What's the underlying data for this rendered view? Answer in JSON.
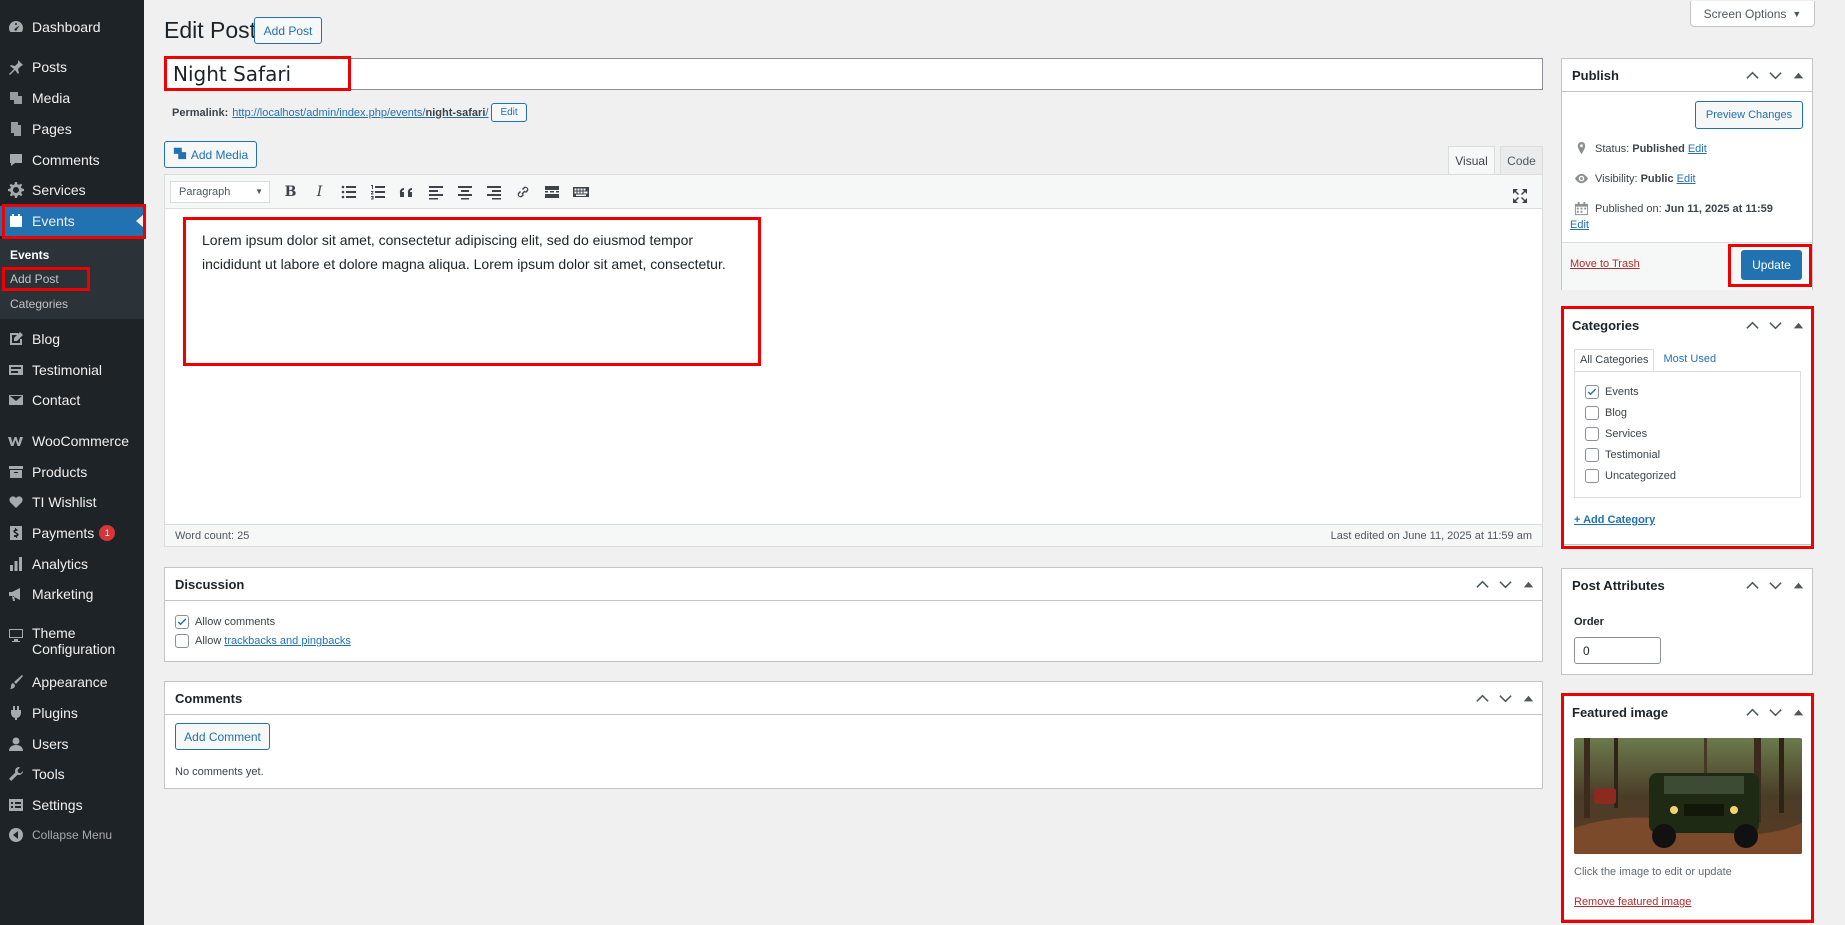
{
  "sidebar": {
    "items": [
      {
        "label": "Dashboard",
        "icon": "dashboard-icon"
      },
      {
        "label": "Posts",
        "icon": "pin-icon"
      },
      {
        "label": "Media",
        "icon": "media-icon"
      },
      {
        "label": "Pages",
        "icon": "pages-icon"
      },
      {
        "label": "Comments",
        "icon": "comments-icon"
      },
      {
        "label": "Services",
        "icon": "gear-icon"
      },
      {
        "label": "Events",
        "icon": "events-icon"
      },
      {
        "label": "Blog",
        "icon": "edit-icon"
      },
      {
        "label": "Testimonial",
        "icon": "testimonial-icon"
      },
      {
        "label": "Contact",
        "icon": "mail-icon"
      },
      {
        "label": "WooCommerce",
        "icon": "woocommerce-icon"
      },
      {
        "label": "Products",
        "icon": "archive-icon"
      },
      {
        "label": "TI Wishlist",
        "icon": "heart-icon"
      },
      {
        "label": "Payments",
        "icon": "dollar-icon",
        "badge": "1"
      },
      {
        "label": "Analytics",
        "icon": "chart-bar-icon"
      },
      {
        "label": "Marketing",
        "icon": "megaphone-icon"
      },
      {
        "label": "Theme",
        "label2": "Configuration",
        "icon": "desktop-icon"
      },
      {
        "label": "Appearance",
        "icon": "paintbrush-icon"
      },
      {
        "label": "Plugins",
        "icon": "plugin-icon"
      },
      {
        "label": "Users",
        "icon": "user-icon"
      },
      {
        "label": "Tools",
        "icon": "wrench-icon"
      },
      {
        "label": "Settings",
        "icon": "settings-icon"
      }
    ],
    "submenu": {
      "heading": "Events",
      "add_post": "Add Post",
      "categories": "Categories"
    },
    "collapse_label": "Collapse Menu"
  },
  "header": {
    "title": "Edit Post",
    "add_post_button": "Add Post",
    "screen_options": "Screen Options"
  },
  "post": {
    "title": "Night Safari",
    "permalink_label": "Permalink:",
    "permalink_base": "http://localhost/admin/index.php/events/",
    "permalink_slug": "night-safari",
    "permalink_trail": "/",
    "permalink_edit": "Edit"
  },
  "editor": {
    "add_media": "Add Media",
    "tab_visual": "Visual",
    "tab_code": "Code",
    "format": "Paragraph",
    "content": "Lorem ipsum dolor sit amet, consectetur adipiscing elit, sed do eiusmod tempor incididunt ut labore et dolore magna aliqua. Lorem ipsum dolor sit amet, consectetur.",
    "word_count": "Word count: 25",
    "last_edited": "Last edited on June 11, 2025 at 11:59 am"
  },
  "discussion": {
    "title": "Discussion",
    "allow_comments": "Allow comments",
    "allow_prefix": "Allow",
    "trackbacks_link": "trackbacks and pingbacks"
  },
  "comments": {
    "title": "Comments",
    "add_comment": "Add Comment",
    "none": "No comments yet."
  },
  "publish": {
    "title": "Publish",
    "preview": "Preview Changes",
    "status_label": "Status:",
    "status_value": "Published",
    "visibility_label": "Visibility:",
    "visibility_value": "Public",
    "published_label": "Published on:",
    "published_value": "Jun 11, 2025 at 11:59",
    "edit": "Edit",
    "trash": "Move to Trash",
    "update": "Update"
  },
  "categories": {
    "title": "Categories",
    "tab_all": "All Categories",
    "tab_most_used": "Most Used",
    "items": [
      {
        "label": "Events",
        "checked": true
      },
      {
        "label": "Blog",
        "checked": false
      },
      {
        "label": "Services",
        "checked": false
      },
      {
        "label": "Testimonial",
        "checked": false
      },
      {
        "label": "Uncategorized",
        "checked": false
      }
    ],
    "add_category": "+ Add Category"
  },
  "attributes": {
    "title": "Post Attributes",
    "order_label": "Order",
    "order_value": "0"
  },
  "featured": {
    "title": "Featured image",
    "hint": "Click the image to edit or update",
    "remove": "Remove featured image"
  },
  "colors": {
    "sidebar_bg": "#1d2327",
    "accent": "#2271b1",
    "highlight_box": "#e00000",
    "trash": "#b32d2e"
  }
}
